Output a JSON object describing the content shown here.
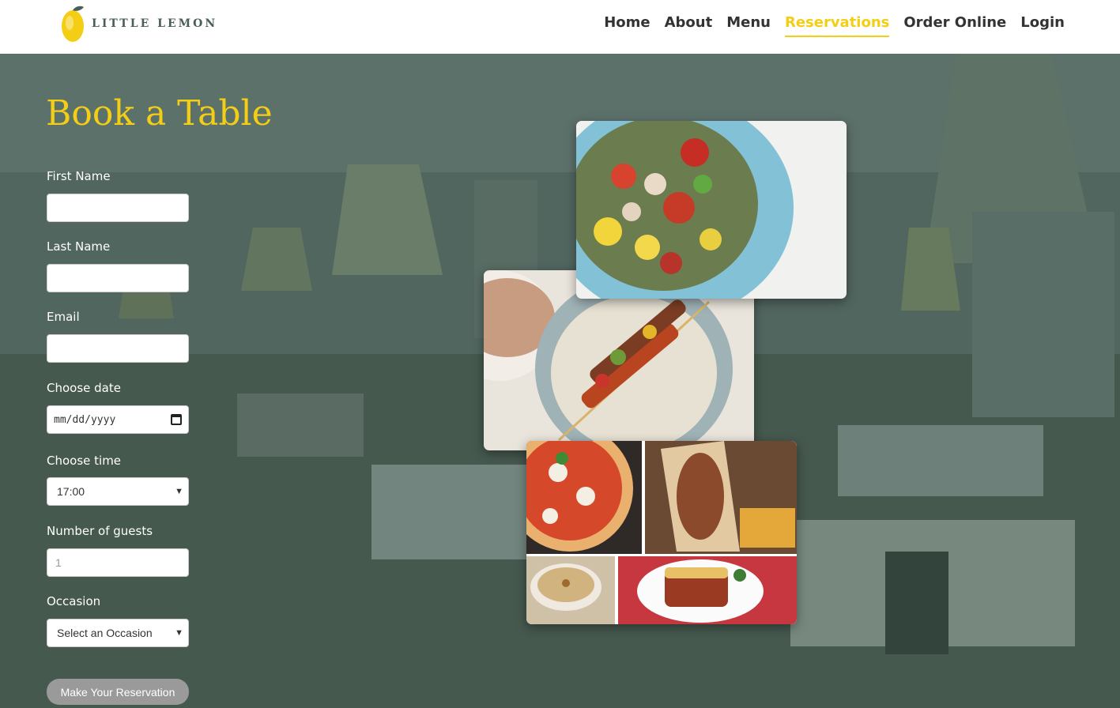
{
  "header": {
    "logo_text": "LITTLE LEMON",
    "nav": [
      {
        "label": "Home",
        "active": false
      },
      {
        "label": "About",
        "active": false
      },
      {
        "label": "Menu",
        "active": false
      },
      {
        "label": "Reservations",
        "active": true
      },
      {
        "label": "Order Online",
        "active": false
      },
      {
        "label": "Login",
        "active": false
      }
    ]
  },
  "form": {
    "title": "Book a Table",
    "first_name_label": "First Name",
    "first_name_value": "",
    "last_name_label": "Last Name",
    "last_name_value": "",
    "email_label": "Email",
    "email_value": "",
    "date_label": "Choose date",
    "date_placeholder": "mm/dd/yyyy",
    "time_label": "Choose time",
    "time_value": "17:00",
    "guests_label": "Number of guests",
    "guests_placeholder": "1",
    "occasion_label": "Occasion",
    "occasion_value": "Select an Occasion",
    "submit_label": "Make Your Reservation"
  },
  "colors": {
    "brand_green": "#495e57",
    "brand_yellow": "#f4ce14",
    "submit_disabled": "#9a9a9a"
  },
  "images": [
    {
      "name": "salad-photo"
    },
    {
      "name": "skewers-photo"
    },
    {
      "name": "pizza-photo"
    },
    {
      "name": "gyro-photo"
    },
    {
      "name": "hummus-photo"
    },
    {
      "name": "moussaka-photo"
    }
  ]
}
